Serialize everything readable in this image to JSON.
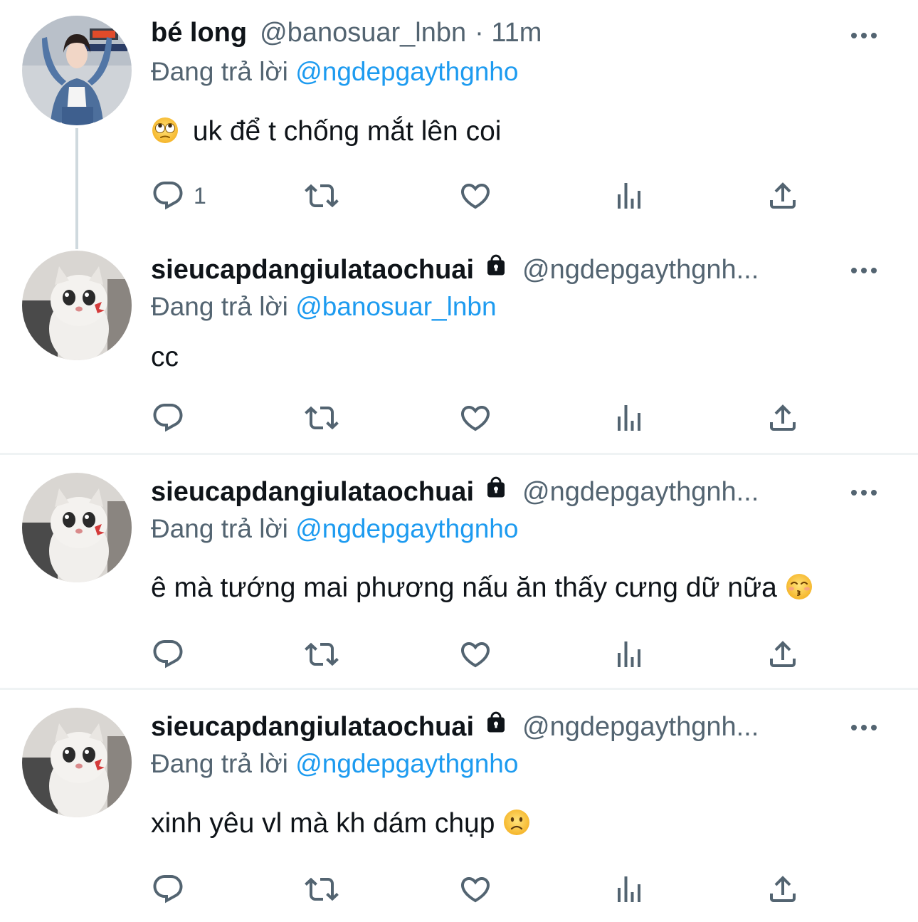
{
  "tweets": [
    {
      "name": "bé long",
      "handle": "@banosuar_lnbn",
      "time": "· 11m",
      "replying_prefix": "Đang trả lời",
      "replying_to": "@ngdepgaythgnho",
      "text": "uk để t chống mắt lên coi",
      "emoji_lead": "rolling-eyes-emoji",
      "reply_count": "1",
      "locked": false
    },
    {
      "name": "sieucapdangiulataochuai",
      "handle": "@ngdepgaythgnh...",
      "replying_prefix": "Đang trả lời",
      "replying_to": "@banosuar_lnbn",
      "text": "cc",
      "reply_count": "",
      "locked": true
    },
    {
      "name": "sieucapdangiulataochuai",
      "handle": "@ngdepgaythgnh...",
      "replying_prefix": "Đang trả lời",
      "replying_to": "@ngdepgaythgnho",
      "text": "ê mà tướng mai phương nấu ăn thấy cưng dữ nữa",
      "emoji_trail": "kissing-smiling-eyes-emoji",
      "reply_count": "",
      "locked": true
    },
    {
      "name": "sieucapdangiulataochuai",
      "handle": "@ngdepgaythgnh...",
      "replying_prefix": "Đang trả lời",
      "replying_to": "@ngdepgaythgnho",
      "text": "xinh yêu vl mà kh dám chụp",
      "emoji_trail": "slightly-frowning-emoji",
      "reply_count": "",
      "locked": true
    }
  ],
  "colors": {
    "text": "#0f1419",
    "secondary": "#536471",
    "link": "#1d9bf0",
    "divider": "#eff3f4",
    "thread_line": "#cfd9de"
  }
}
